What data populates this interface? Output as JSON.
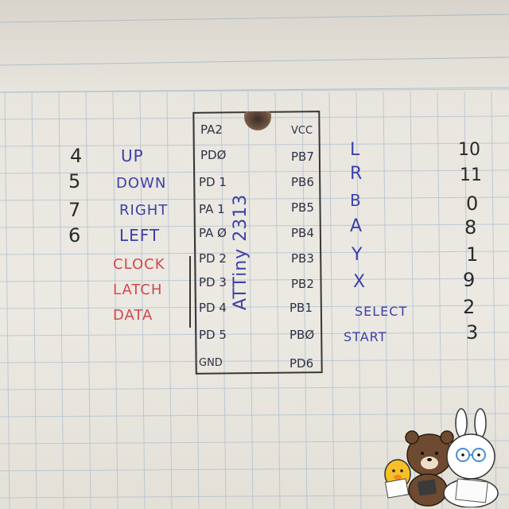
{
  "chip": {
    "name": "ATTiny 2313",
    "left_pins": [
      "PA2",
      "PDØ",
      "PD 1",
      "PA 1",
      "PA Ø",
      "PD 2",
      "PD 3",
      "PD 4",
      "PD 5",
      "GND"
    ],
    "right_pins": [
      "VCC",
      "PB7",
      "PB6",
      "PB5",
      "PB4",
      "PB3",
      "PB2",
      "PB1",
      "PBØ",
      "PD6"
    ]
  },
  "left_numbers": [
    "4",
    "5",
    "7",
    "6"
  ],
  "left_labels": [
    {
      "text": "UP",
      "color": "#3c3fa8"
    },
    {
      "text": "DOWN",
      "color": "#3c3fa8"
    },
    {
      "text": "RIGHT",
      "color": "#3c3fa8"
    },
    {
      "text": "LEFT",
      "color": "#3c3fa8"
    },
    {
      "text": "CLOCK",
      "color": "#d0484c"
    },
    {
      "text": "LATCH",
      "color": "#d0484c"
    },
    {
      "text": "DATA",
      "color": "#d0484c"
    }
  ],
  "right_labels": [
    "L",
    "R",
    "B",
    "A",
    "Y",
    "X",
    "SELECT",
    "START"
  ],
  "right_numbers": [
    "10",
    "11",
    "0",
    "8",
    "1",
    "9",
    "2",
    "3"
  ],
  "colors": {
    "ink_blue": "#3c3fa8",
    "ink_red": "#d0484c",
    "pencil": "#2f3146",
    "grid_line": "#9fb3c6"
  },
  "decoration": {
    "icon": "line-friends-mascots-icon"
  }
}
